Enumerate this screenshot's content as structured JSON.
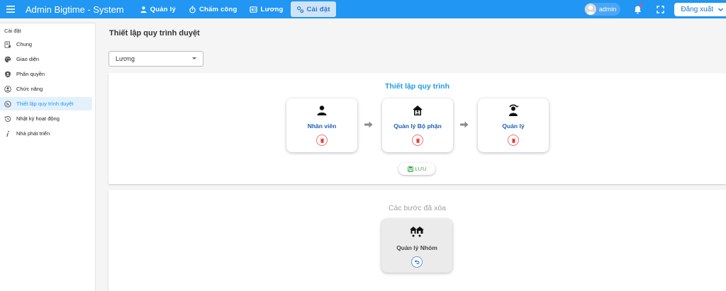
{
  "app": {
    "title": "Admin Bigtime - System"
  },
  "nav": {
    "items": [
      {
        "label": "Quản lý",
        "icon": "person-icon"
      },
      {
        "label": "Chấm công",
        "icon": "stopwatch-icon"
      },
      {
        "label": "Lương",
        "icon": "payroll-icon"
      },
      {
        "label": "Cài đặt",
        "icon": "settings-cogs-icon",
        "active": true
      }
    ]
  },
  "header_right": {
    "username": "admin",
    "logout_label": "Đăng xuất"
  },
  "sidebar": {
    "header": "Cài đặt",
    "items": [
      {
        "label": "Chung",
        "icon": "document-settings-icon"
      },
      {
        "label": "Giao diện",
        "icon": "palette-icon"
      },
      {
        "label": "Phân quyền",
        "icon": "shield-icon"
      },
      {
        "label": "Chức năng",
        "icon": "account-circle-icon"
      },
      {
        "label": "Thiết lập quy trình duyệt",
        "icon": "workflow-icon",
        "active": true
      },
      {
        "label": "Nhật ký hoạt động",
        "icon": "history-icon"
      },
      {
        "label": "Nhà phát triển",
        "icon": "info-italic-icon"
      }
    ]
  },
  "main": {
    "page_title": "Thiết lập quy trình duyệt",
    "select_value": "Lương",
    "flow_panel": {
      "title": "Thiết lập quy trình",
      "steps": [
        {
          "label": "Nhân viên",
          "icon": "person-icon"
        },
        {
          "label": "Quản lý Bộ phận",
          "icon": "home-person-icon"
        },
        {
          "label": "Quản lý",
          "icon": "manager-icon"
        }
      ],
      "save_label": "LƯU"
    },
    "deleted_panel": {
      "title": "Các bước đã xóa",
      "steps": [
        {
          "label": "Quản lý Nhóm",
          "icon": "group-homes-icon"
        }
      ]
    }
  },
  "colors": {
    "primary": "#2196f3",
    "flow_title": "#1e9be6",
    "step_label": "#1f5fae",
    "delete": "#f07470",
    "save": "#43a047"
  }
}
